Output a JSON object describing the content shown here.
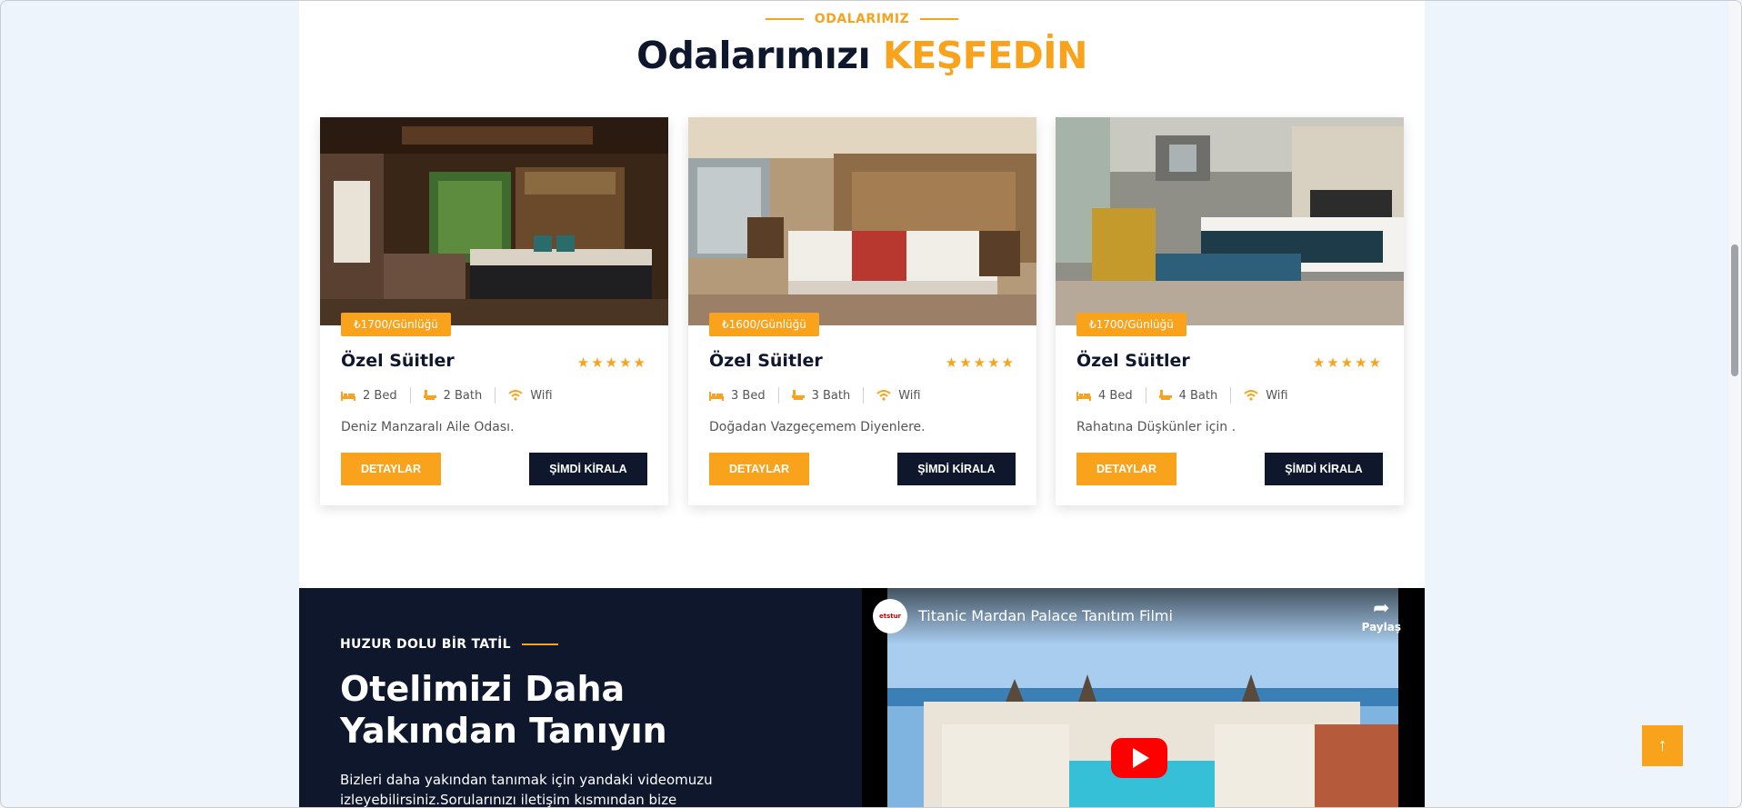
{
  "section": {
    "eyebrow": "ODALARIMIZ",
    "title_main": "Odalarımızı",
    "title_accent": "KEŞFEDİN"
  },
  "rooms": [
    {
      "price": "₺1700/Günlüğü",
      "name": "Özel Süitler",
      "stars": "★★★★★",
      "beds": "2 Bed",
      "baths": "2 Bath",
      "wifi": "Wifi",
      "description": "Deniz Manzaralı Aile Odası.",
      "details_label": "DETAYLAR",
      "rent_label": "ŞİMDİ KİRALA"
    },
    {
      "price": "₺1600/Günlüğü",
      "name": "Özel Süitler",
      "stars": "★★★★★",
      "beds": "3 Bed",
      "baths": "3 Bath",
      "wifi": "Wifi",
      "description": "Doğadan Vazgeçemem Diyenlere.",
      "details_label": "DETAYLAR",
      "rent_label": "ŞİMDİ KİRALA"
    },
    {
      "price": "₺1700/Günlüğü",
      "name": "Özel Süitler",
      "stars": "★★★★★",
      "beds": "4 Bed",
      "baths": "4 Bath",
      "wifi": "Wifi",
      "description": "Rahatına Düşkünler için .",
      "details_label": "DETAYLAR",
      "rent_label": "ŞİMDİ KİRALA"
    }
  ],
  "about": {
    "eyebrow": "HUZUR DOLU BİR TATİL",
    "heading": "Otelimizi Daha Yakından Tanıyın",
    "paragraph": "Bizleri daha yakından tanımak için yandaki videomuzu izleyebilirsiniz.Sorularınızı iletişim kısmından bize aktarabilirsiniz."
  },
  "video": {
    "channel_logo_text": "etstur",
    "title": "Titanic Mardan Palace Tanıtım Filmi",
    "share_label": "Paylaş"
  },
  "icons": {
    "bed": "bed-icon",
    "bath": "bath-icon",
    "wifi": "wifi-icon",
    "play": "play-icon",
    "share": "share-icon",
    "scroll_top": "arrow-up-icon"
  },
  "scroll_top_glyph": "↑",
  "colors": {
    "accent": "#f9a21c",
    "navy": "#0e172b",
    "page_bg": "#eef4fb"
  }
}
